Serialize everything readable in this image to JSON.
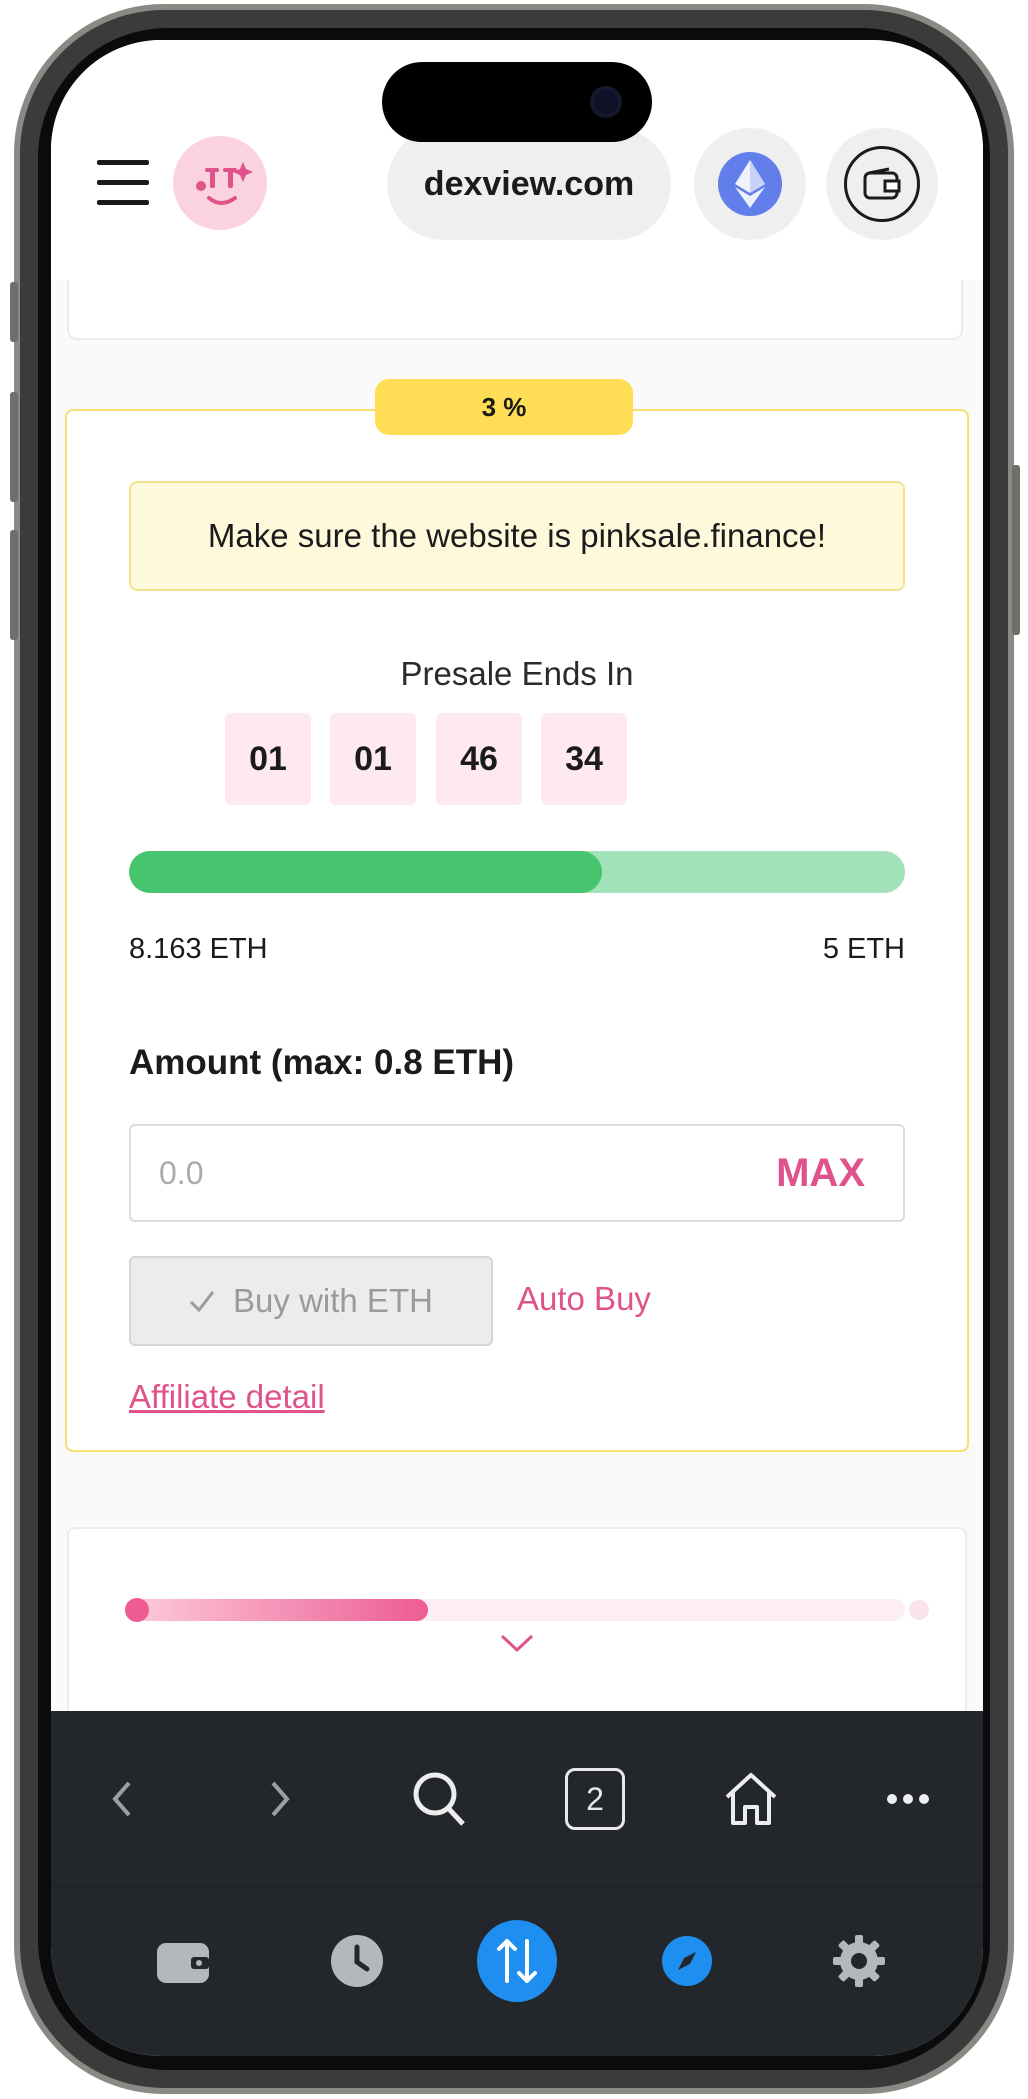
{
  "header": {
    "url": "dexview.com",
    "network": "ethereum",
    "icons": [
      "menu-icon",
      "pinksale-logo",
      "ethereum-icon",
      "wallet-icon"
    ]
  },
  "presale": {
    "badge": "3 %",
    "warning": "Make sure the website is pinksale.finance!",
    "ends_label": "Presale Ends In",
    "countdown": [
      "01",
      "01",
      "46",
      "34"
    ],
    "progress_fraction": 0.61,
    "raised": "8.163 ETH",
    "target": "5 ETH",
    "amount_label": "Amount (max: 0.8 ETH)",
    "amount_placeholder": "0.0",
    "max_label": "MAX",
    "buy_label": "Buy with ETH",
    "auto_buy_label": "Auto Buy",
    "affiliate_label": "Affiliate detail"
  },
  "stepper": {
    "progress_fraction": 0.38
  },
  "browser_toolbar": {
    "tab_count": "2",
    "items": [
      "back-icon",
      "forward-icon",
      "search-icon",
      "tabs-icon",
      "home-icon",
      "more-icon"
    ]
  },
  "dock": {
    "items": [
      "wallet-icon",
      "history-icon",
      "swap-icon",
      "discover-icon",
      "settings-icon"
    ]
  },
  "colors": {
    "accent_pink": "#e0528a",
    "progress_green": "#46c46e",
    "progress_track": "#a3e1b8",
    "badge_yellow": "#ffdd55",
    "warning_bg": "#fff9dc",
    "timer_bg": "#fde9ee",
    "toolbar_bg": "#23272b",
    "swap_blue": "#1e8ff0",
    "eth_blue": "#627eea"
  }
}
